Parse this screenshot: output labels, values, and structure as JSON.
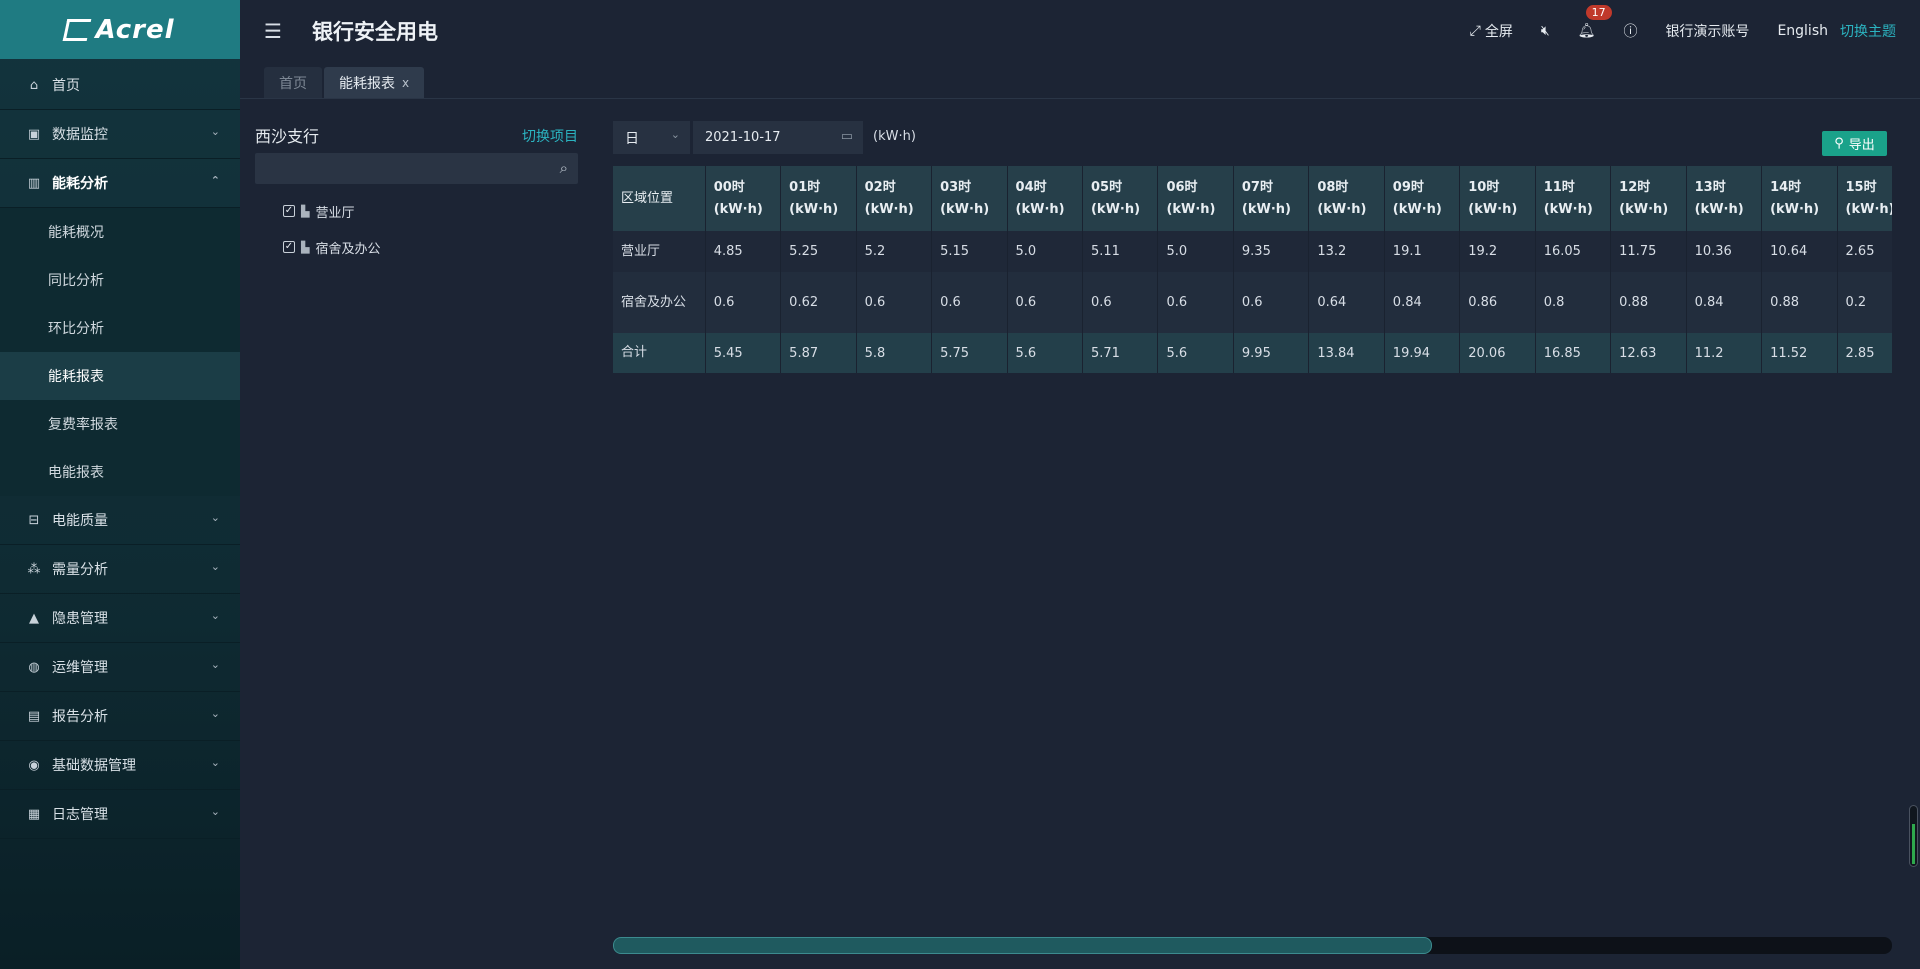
{
  "brand": {
    "logo_text": "Acrel"
  },
  "header": {
    "title": "银行安全用电",
    "fullscreen_label": "全屏",
    "notification_count": "17",
    "account_name": "银行演示账号",
    "language": "English",
    "theme_switch": "切换主题"
  },
  "sidebar": {
    "items": [
      {
        "label": "首页",
        "icon": "home-icon"
      },
      {
        "label": "数据监控",
        "icon": "monitor-icon"
      },
      {
        "label": "能耗分析",
        "icon": "bar-chart-icon"
      },
      {
        "label": "电能质量",
        "icon": "power-quality-icon"
      },
      {
        "label": "需量分析",
        "icon": "demand-icon"
      },
      {
        "label": "隐患管理",
        "icon": "warning-icon"
      },
      {
        "label": "运维管理",
        "icon": "maintenance-icon"
      },
      {
        "label": "报告分析",
        "icon": "report-icon"
      },
      {
        "label": "基础数据管理",
        "icon": "database-icon"
      },
      {
        "label": "日志管理",
        "icon": "log-icon"
      }
    ],
    "submenu": [
      "能耗概况",
      "同比分析",
      "环比分析",
      "能耗报表",
      "复费率报表",
      "电能报表"
    ],
    "active_sub": "能耗报表"
  },
  "tabs": [
    {
      "label": "首页"
    },
    {
      "label": "能耗报表",
      "close": "x"
    }
  ],
  "tree": {
    "title": "西沙支行",
    "switch_label": "切换项目",
    "search_placeholder": "",
    "nodes": [
      "营业厅",
      "宿舍及办公"
    ]
  },
  "toolbar": {
    "period": "日",
    "date": "2021-10-17",
    "unit": "(kW·h)",
    "export_label": "导出"
  },
  "table": {
    "header_first": "区域位置",
    "hours": [
      "00时",
      "01时",
      "02时",
      "03时",
      "04时",
      "05时",
      "06时",
      "07时",
      "08时",
      "09时",
      "10时",
      "11时",
      "12时",
      "13时",
      "14时",
      "15时"
    ],
    "hour_unit": "(kW·h)",
    "rows": [
      {
        "name": "营业厅",
        "values": [
          "4.85",
          "5.25",
          "5.2",
          "5.15",
          "5.0",
          "5.11",
          "5.0",
          "9.35",
          "13.2",
          "19.1",
          "19.2",
          "16.05",
          "11.75",
          "10.36",
          "10.64",
          "2.65"
        ]
      },
      {
        "name": "宿舍及办公",
        "values": [
          "0.6",
          "0.62",
          "0.6",
          "0.6",
          "0.6",
          "0.6",
          "0.6",
          "0.6",
          "0.64",
          "0.84",
          "0.86",
          "0.8",
          "0.88",
          "0.84",
          "0.88",
          "0.2"
        ]
      },
      {
        "name": "合计",
        "values": [
          "5.45",
          "5.87",
          "5.8",
          "5.75",
          "5.6",
          "5.71",
          "5.6",
          "9.95",
          "13.84",
          "19.94",
          "20.06",
          "16.85",
          "12.63",
          "11.2",
          "11.52",
          "2.85"
        ]
      }
    ]
  },
  "scroll": {
    "horizontal_fraction": 0.64
  }
}
